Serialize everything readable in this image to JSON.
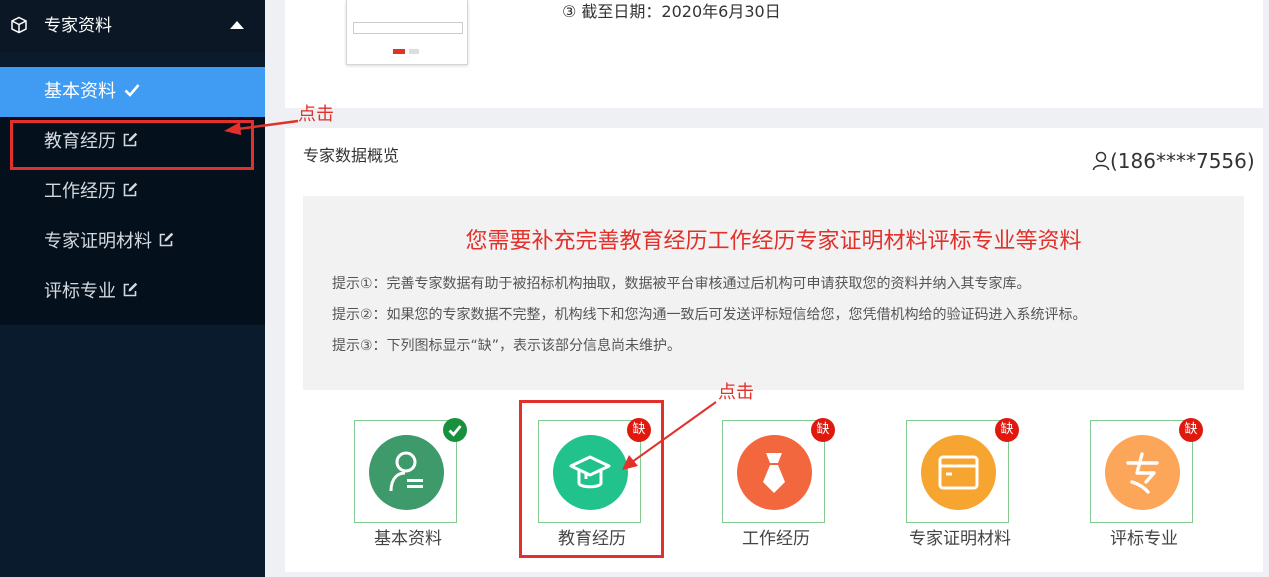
{
  "sidebar": {
    "section_title": "专家资料",
    "items": [
      {
        "label": "基本资料",
        "status": "done"
      },
      {
        "label": "教育经历",
        "status": "edit"
      },
      {
        "label": "工作经历",
        "status": "edit"
      },
      {
        "label": "专家证明材料",
        "status": "edit"
      },
      {
        "label": "评标专业",
        "status": "edit"
      }
    ]
  },
  "top_card": {
    "deadline": "③ 截至日期：2020年6月30日"
  },
  "main": {
    "title": "专家数据概览",
    "user_phone": "(186****7556)",
    "headline": "您需要补充完善教育经历工作经历专家证明材料评标专业等资料",
    "tips": [
      "提示①：完善专家数据有助于被招标机构抽取，数据被平台审核通过后机构可申请获取您的资料并纳入其专家库。",
      "提示②：如果您的专家数据不完整，机构线下和您沟通一致后可发送评标短信给您，您凭借机构给的验证码进入系统评标。",
      "提示③：下列图标显示“缺”，表示该部分信息尚未维护。"
    ],
    "tiles": [
      {
        "label": "基本资料",
        "badge": "",
        "color": "#3e9a6b"
      },
      {
        "label": "教育经历",
        "badge": "缺",
        "color": "#21c28b"
      },
      {
        "label": "工作经历",
        "badge": "缺",
        "color": "#f2673e"
      },
      {
        "label": "专家证明材料",
        "badge": "缺",
        "color": "#f7a531"
      },
      {
        "label": "评标专业",
        "badge": "缺",
        "color": "#fca65a"
      }
    ]
  },
  "annotations": {
    "click_text": "点击"
  },
  "colors": {
    "sidebar_bg": "#0a1b2d",
    "active_item": "#3f9cf2",
    "highlight_red": "#e2302b",
    "badge_red": "#e0190f",
    "badge_green": "#18913f"
  }
}
